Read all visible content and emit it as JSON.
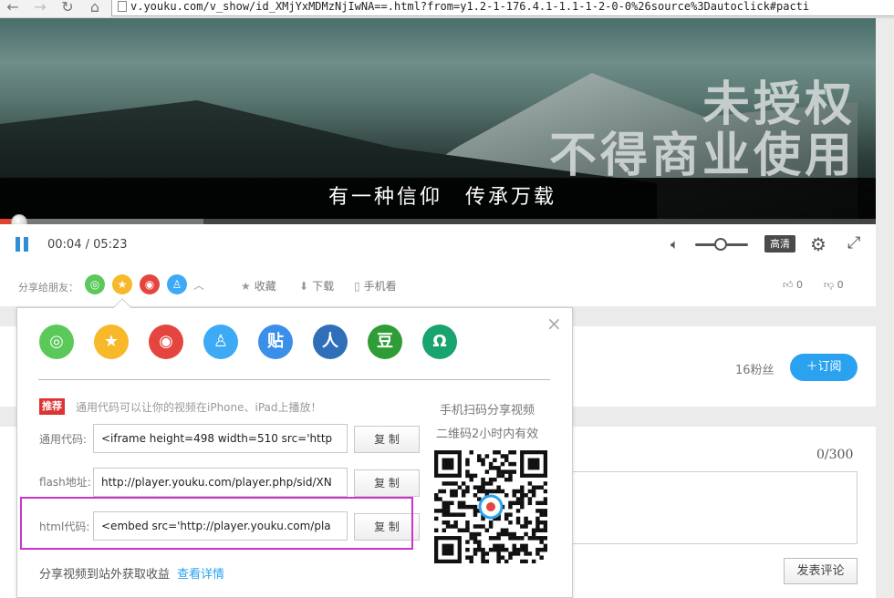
{
  "browser": {
    "url": "v.youku.com/v_show/id_XMjYxMDMzNjIwNA==.html?from=y1.2-1-176.4.1-1.1-1-2-0-0%26source%3Dautoclick#pacti"
  },
  "video": {
    "watermark_line1": "未授权",
    "watermark_line2": "不得商业使用",
    "subtitle": "有一种信仰　传承万载",
    "progress_fraction": 0.0126,
    "buffer_fraction": 0.232
  },
  "controls": {
    "time": "00:04 / 05:23",
    "quality": "高清",
    "volume_fraction": 0.5
  },
  "share_row": {
    "label": "分享给朋友：",
    "favorite": "收藏",
    "download": "下载",
    "mobile": "手机看",
    "likes": "0",
    "dislikes": "0"
  },
  "popup": {
    "share_icons": [
      {
        "name": "wechat",
        "glyph": "◎",
        "color": "#5ac95a"
      },
      {
        "name": "qzone",
        "glyph": "★",
        "color": "#f7b829"
      },
      {
        "name": "weibo",
        "glyph": "◉",
        "color": "#e5453f"
      },
      {
        "name": "qq",
        "glyph": "♙",
        "color": "#3daaf5"
      },
      {
        "name": "tieba",
        "glyph": "贴",
        "color": "#3a8fe8"
      },
      {
        "name": "renren",
        "glyph": "人",
        "color": "#2f6fba"
      },
      {
        "name": "douban",
        "glyph": "豆",
        "color": "#2e9d35"
      },
      {
        "name": "other",
        "glyph": "Ω",
        "color": "#19a36e"
      }
    ],
    "recommend_badge": "推荐",
    "recommend_text": "通用代码可以让你的视频在iPhone、iPad上播放！",
    "fields": [
      {
        "label": "通用代码:",
        "value": "<iframe height=498 width=510 src='http",
        "copy": "复 制"
      },
      {
        "label": "flash地址:",
        "value": "http://player.youku.com/player.php/sid/XN",
        "copy": "复 制"
      },
      {
        "label": "html代码:",
        "value": "<embed src='http://player.youku.com/pla",
        "copy": "复 制"
      }
    ],
    "qr_title": "手机扫码分享视频",
    "qr_note": "二维码2小时内有效",
    "earn_text": "分享视频到站外获取收益",
    "earn_link": "查看详情"
  },
  "channel": {
    "fans": "16粉丝",
    "subscribe": "＋订阅"
  },
  "comment": {
    "counter": "0/300",
    "post": "发表评论"
  }
}
